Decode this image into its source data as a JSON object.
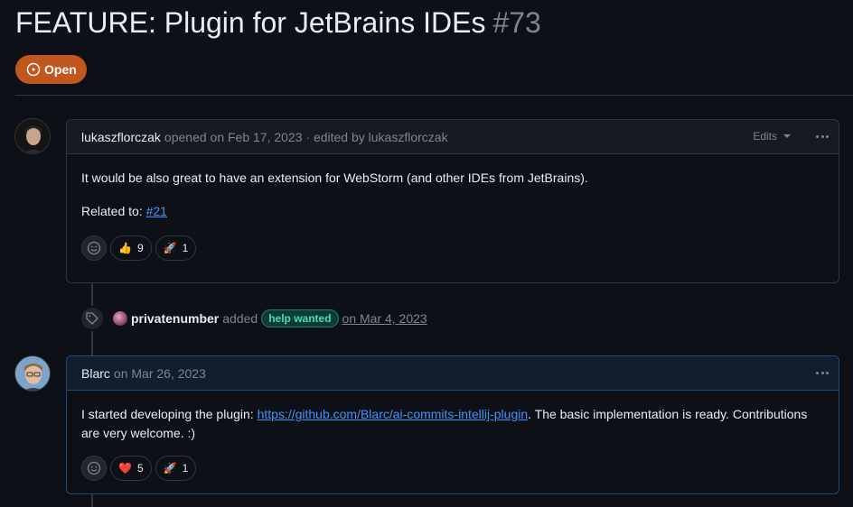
{
  "issue": {
    "title": "FEATURE: Plugin for JetBrains IDEs",
    "number": "#73",
    "state": "Open"
  },
  "comments": [
    {
      "author": "lukaszflorczak",
      "meta": "opened on Feb 17, 2023 · edited by lukaszflorczak",
      "edits_label": "Edits",
      "body": [
        "It would be also great to have an extension for WebStorm (and other IDEs from JetBrains)."
      ],
      "related_prefix": "Related to: ",
      "related_link": "#21",
      "reactions": [
        {
          "emoji": "👍",
          "count": "9"
        },
        {
          "emoji": "🚀",
          "count": "1"
        }
      ]
    },
    {
      "author": "Blarc",
      "meta": "on Mar 26, 2023",
      "body_prefix": "I started developing the plugin: ",
      "body_link": "https://github.com/Blarc/ai-commits-intellij-plugin",
      "body_suffix": ". The basic implementation is ready. Contributions are very welcome. :)",
      "reactions": [
        {
          "emoji": "❤️",
          "count": "5"
        },
        {
          "emoji": "🚀",
          "count": "1"
        }
      ]
    }
  ],
  "event": {
    "actor": "privatenumber",
    "action": "added",
    "label": "help wanted",
    "date": "on Mar 4, 2023"
  },
  "colors": {
    "open_badge": "#c2571e",
    "link": "#4493f8",
    "label_text": "#3fe0b8"
  }
}
